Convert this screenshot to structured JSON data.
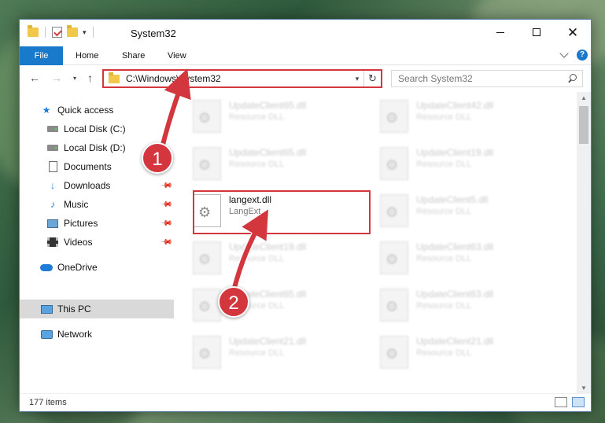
{
  "window": {
    "title": "System32"
  },
  "ribbon": {
    "tabs": [
      {
        "label": "File"
      },
      {
        "label": "Home"
      },
      {
        "label": "Share"
      },
      {
        "label": "View"
      }
    ]
  },
  "address": {
    "path": "C:\\Windows\\System32"
  },
  "search": {
    "placeholder": "Search System32"
  },
  "nav": {
    "items": [
      {
        "label": "Quick access"
      },
      {
        "label": "Local Disk (C:)"
      },
      {
        "label": "Local Disk (D:)"
      },
      {
        "label": "Documents"
      },
      {
        "label": "Downloads"
      },
      {
        "label": "Music"
      },
      {
        "label": "Pictures"
      },
      {
        "label": "Videos"
      },
      {
        "label": "OneDrive"
      },
      {
        "label": "This PC"
      },
      {
        "label": "Network"
      }
    ]
  },
  "files": [
    {
      "name": "UpdateClient65.dll",
      "desc": "Resource DLL"
    },
    {
      "name": "UpdateClient42.dll",
      "desc": "Resource DLL"
    },
    {
      "name": "UpdateClient65.dll",
      "desc": "Resource DLL"
    },
    {
      "name": "UpdateClient19.dll",
      "desc": "Resource DLL"
    },
    {
      "name": "langext.dll",
      "desc": "LangExt"
    },
    {
      "name": "UpdateClient5.dll",
      "desc": "Resource DLL"
    },
    {
      "name": "UpdateClient19.dll",
      "desc": "Resource DLL"
    },
    {
      "name": "UpdateClient63.dll",
      "desc": "Resource DLL"
    },
    {
      "name": "UpdateClient65.dll",
      "desc": "Resource DLL"
    },
    {
      "name": "UpdateClient63.dll",
      "desc": "Resource DLL"
    },
    {
      "name": "UpdateClient21.dll",
      "desc": "Resource DLL"
    },
    {
      "name": "UpdateClient21.dll",
      "desc": "Resource DLL"
    }
  ],
  "status": {
    "count": "177 items"
  },
  "callouts": [
    {
      "label": "1"
    },
    {
      "label": "2"
    }
  ],
  "colors": {
    "accent": "#1979ca",
    "highlight": "#d3363d"
  }
}
